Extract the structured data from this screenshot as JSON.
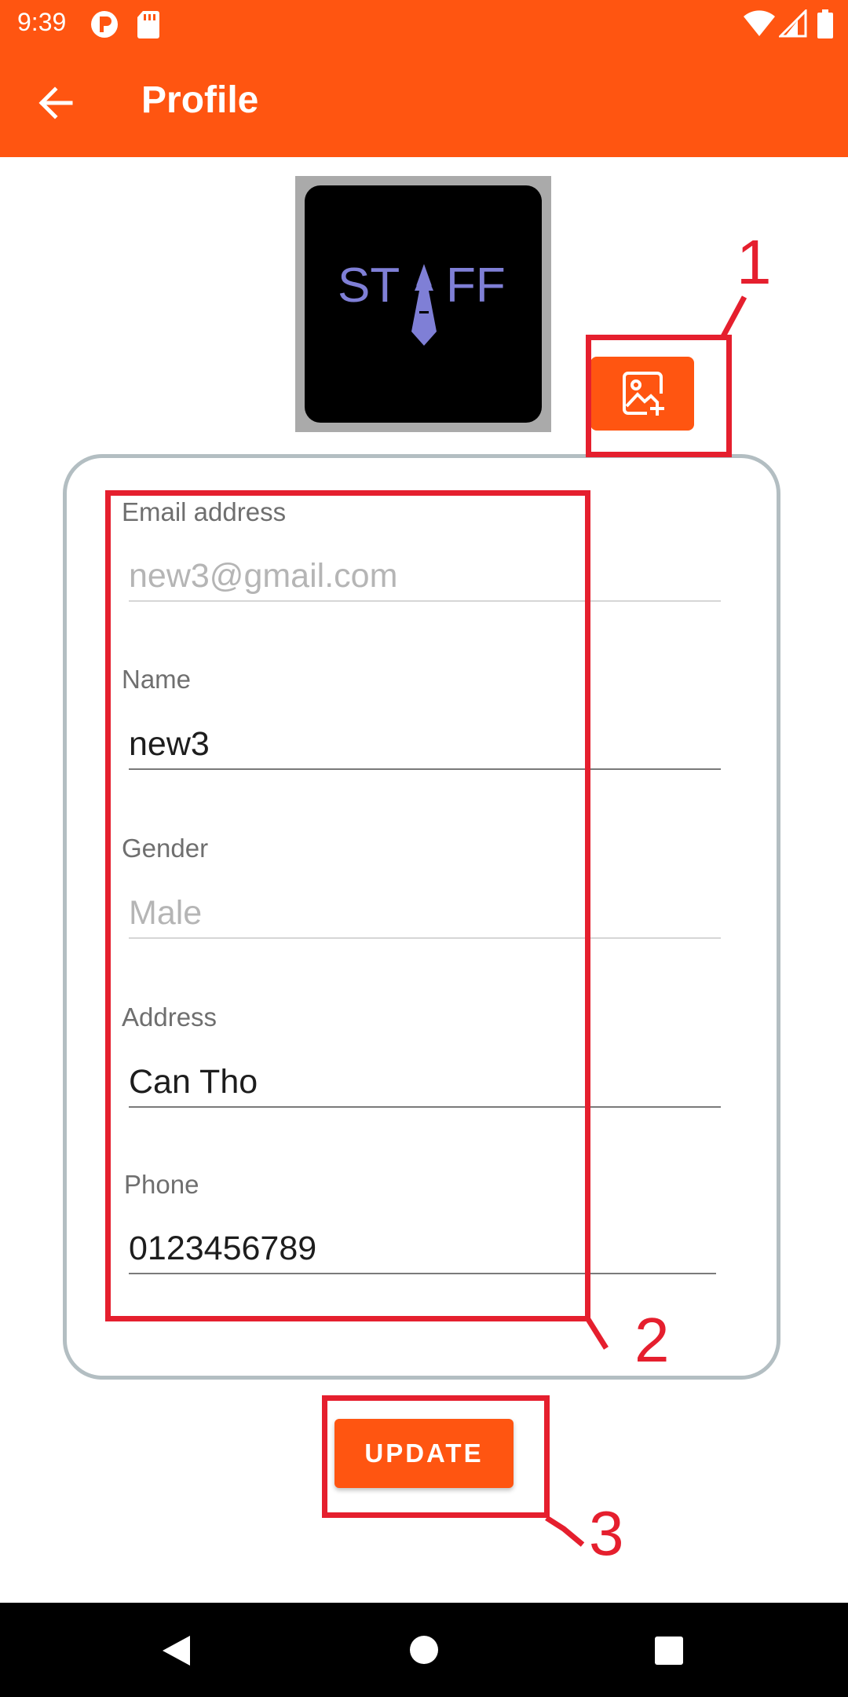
{
  "status_bar": {
    "time": "9:39",
    "icons": [
      "notification-p-icon",
      "sd-card-icon",
      "wifi-icon",
      "signal-icon",
      "battery-icon"
    ]
  },
  "app_bar": {
    "title": "Profile",
    "back_icon": "arrow-back-icon"
  },
  "avatar": {
    "logo_text": "STAFF",
    "add_photo_icon": "add-photo-icon"
  },
  "form": {
    "email": {
      "label": "Email address",
      "value": "new3@gmail.com",
      "enabled": false
    },
    "name": {
      "label": "Name",
      "value": "new3",
      "enabled": true
    },
    "gender": {
      "label": "Gender",
      "value": "Male",
      "enabled": false
    },
    "address": {
      "label": "Address",
      "value": "Can Tho",
      "enabled": true
    },
    "phone": {
      "label": "Phone",
      "value": "0123456789",
      "enabled": true
    }
  },
  "update_button": {
    "label": "UPDATE"
  },
  "annotations": [
    {
      "number": "1"
    },
    {
      "number": "2"
    },
    {
      "number": "3"
    }
  ],
  "nav_bar": {
    "icons": [
      "back-triangle-icon",
      "home-circle-icon",
      "recents-square-icon"
    ]
  },
  "colors": {
    "accent": "#ff5511",
    "annotation": "#e51f2e",
    "card_border": "#b3bec2"
  }
}
